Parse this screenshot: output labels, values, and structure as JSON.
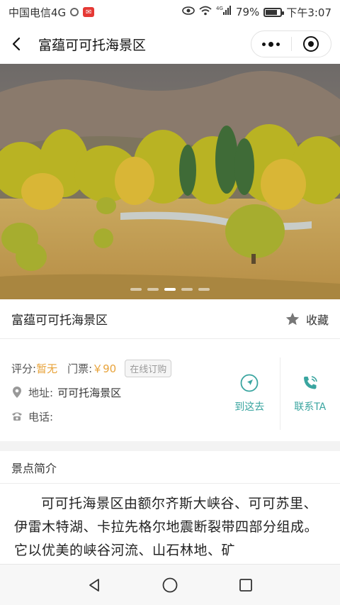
{
  "status_bar": {
    "carrier": "中国电信4G",
    "signal_type": "4G",
    "battery_percent": "79%",
    "battery_level": 0.79,
    "time": "下午3:07"
  },
  "header": {
    "title": "富蕴可可托海景区"
  },
  "hero": {
    "slide_count": 5,
    "active_index": 2
  },
  "place": {
    "name": "富蕴可可托海景区",
    "favorite_label": "收藏"
  },
  "info": {
    "rating_label": "评分:",
    "rating_value": "暂无",
    "ticket_label": "门票:",
    "ticket_value": "￥90",
    "order_button": "在线订购",
    "address_label": "地址:",
    "address_value": "可可托海景区",
    "phone_label": "电话:",
    "phone_value": ""
  },
  "actions": {
    "navigate_label": "到这去",
    "contact_label": "联系TA",
    "accent_color": "#3aa5a0"
  },
  "section": {
    "title": "景点简介",
    "description": "可可托海景区由额尔齐斯大峡谷、可可苏里、伊雷木特湖、卡拉先格尔地震断裂带四部分组成。它以优美的峡谷河流、山石林地、矿"
  },
  "colors": {
    "accent_orange": "#e8a33a",
    "accent_teal": "#3aa5a0"
  }
}
